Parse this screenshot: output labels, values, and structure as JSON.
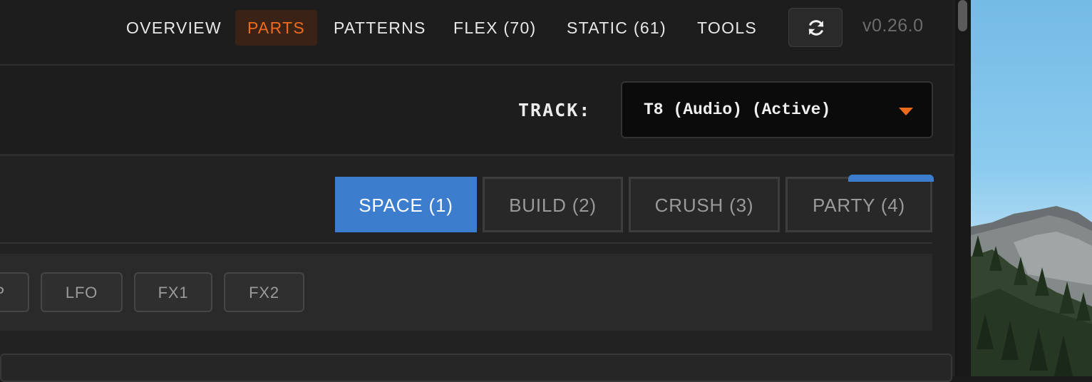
{
  "nav": {
    "items": [
      {
        "label": "OVERVIEW",
        "active": false
      },
      {
        "label": "PARTS",
        "active": true
      },
      {
        "label": "PATTERNS",
        "active": false
      },
      {
        "label": "FLEX (70)",
        "active": false
      },
      {
        "label": "STATIC (61)",
        "active": false
      },
      {
        "label": "TOOLS",
        "active": false
      }
    ],
    "refresh_icon": "refresh-icon",
    "version": "v0.26.0"
  },
  "track": {
    "label": "TRACK:",
    "selected": "T8 (Audio) (Active)"
  },
  "scenes": [
    {
      "label": "SPACE (1)",
      "active": true
    },
    {
      "label": "BUILD (2)",
      "active": false
    },
    {
      "label": "CRUSH (3)",
      "active": false
    },
    {
      "label": "PARTY (4)",
      "active": false
    }
  ],
  "subtabs": [
    {
      "label": "P"
    },
    {
      "label": "LFO"
    },
    {
      "label": "FX1"
    },
    {
      "label": "FX2"
    }
  ],
  "colors": {
    "accent": "#ee6b1c",
    "active_scene": "#3c7dcd",
    "background": "#1d1d1d"
  }
}
